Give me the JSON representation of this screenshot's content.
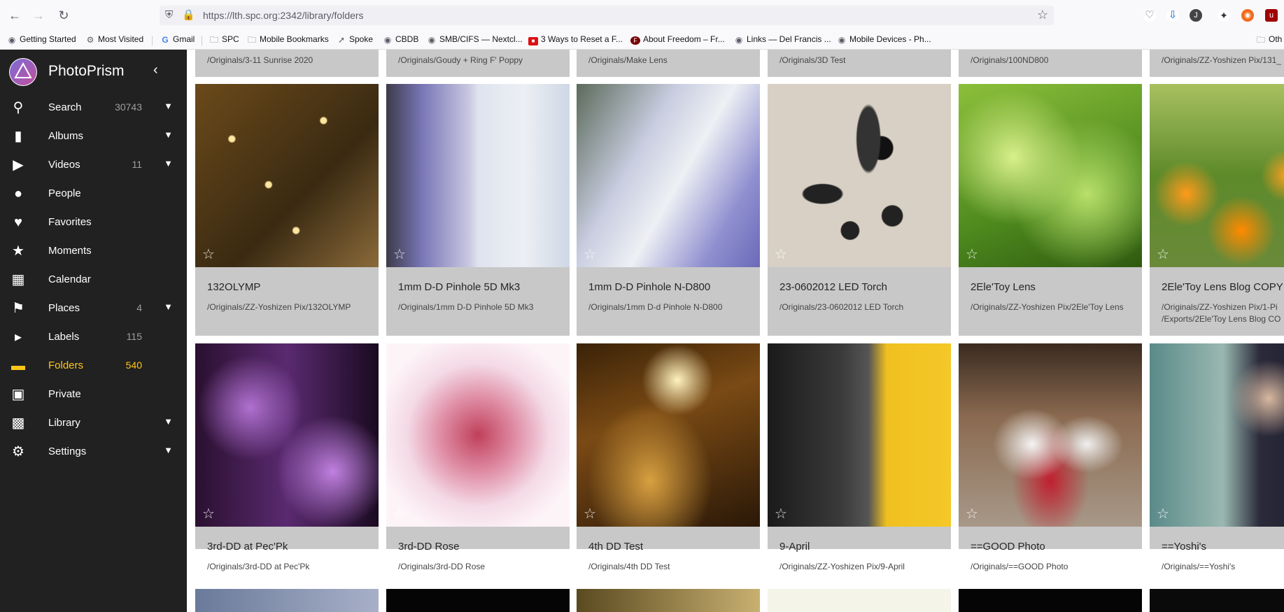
{
  "browser": {
    "url": "https://lth.spc.org:2342/library/folders",
    "bookmarks": [
      "Getting Started",
      "Most Visited",
      "Gmail",
      "SPC",
      "Mobile Bookmarks",
      "Spoke",
      "CBDB",
      "SMB/CIFS — Nextcl...",
      "3 Ways to Reset a F...",
      "About Freedom – Fr...",
      "Links — Del Francis ...",
      "Mobile Devices - Ph...",
      "Oth"
    ]
  },
  "app": {
    "title": "PhotoPrism"
  },
  "sidebar": {
    "items": [
      {
        "label": "Search",
        "count": "30743",
        "icon": "search-icon"
      },
      {
        "label": "Albums",
        "count": "",
        "icon": "bookmark-icon"
      },
      {
        "label": "Videos",
        "count": "11",
        "icon": "play-icon"
      },
      {
        "label": "People",
        "count": "",
        "icon": "person-icon"
      },
      {
        "label": "Favorites",
        "count": "",
        "icon": "heart-icon"
      },
      {
        "label": "Moments",
        "count": "",
        "icon": "star-icon"
      },
      {
        "label": "Calendar",
        "count": "",
        "icon": "calendar-icon"
      },
      {
        "label": "Places",
        "count": "4",
        "icon": "pin-icon"
      },
      {
        "label": "Labels",
        "count": "115",
        "icon": "label-icon"
      },
      {
        "label": "Folders",
        "count": "540",
        "icon": "folder-icon"
      },
      {
        "label": "Private",
        "count": "",
        "icon": "lock-icon"
      },
      {
        "label": "Library",
        "count": "",
        "icon": "library-icon"
      },
      {
        "label": "Settings",
        "count": "",
        "icon": "gear-icon"
      }
    ]
  },
  "top_row": [
    "/Originals/3-11 Sunrise 2020",
    "/Originals/Goudy + Ring F' Poppy",
    "/Originals/Make Lens",
    "/Originals/3D Test",
    "/Originals/100ND800",
    "/Originals/ZZ-Yoshizen Pix/131_"
  ],
  "row1": [
    {
      "title": "132OLYMP",
      "path": "/Originals/ZZ-Yoshizen Pix/132OLYMP",
      "path2": ""
    },
    {
      "title": "1mm D-D Pinhole 5D Mk3",
      "path": "/Originals/1mm D-D Pinhole 5D Mk3",
      "path2": ""
    },
    {
      "title": "1mm D-D Pinhole N-D800",
      "path": "/Originals/1mm D-d Pinhole N-D800",
      "path2": ""
    },
    {
      "title": "23-0602012 LED Torch",
      "path": "/Originals/23-0602012 LED Torch",
      "path2": ""
    },
    {
      "title": "2Ele'Toy Lens",
      "path": "/Originals/ZZ-Yoshizen Pix/2Ele'Toy Lens",
      "path2": ""
    },
    {
      "title": "2Ele'Toy Lens Blog COPY",
      "path": "/Originals/ZZ-Yoshizen Pix/1-Pi",
      "path2": "/Exports/2Ele'Toy Lens Blog CO"
    }
  ],
  "row2": [
    {
      "title": "3rd-DD at Pec'Pk",
      "path": "/Originals/3rd-DD at Pec'Pk"
    },
    {
      "title": "3rd-DD Rose",
      "path": "/Originals/3rd-DD Rose"
    },
    {
      "title": "4th DD Test",
      "path": "/Originals/4th DD Test"
    },
    {
      "title": "9-April",
      "path": "/Originals/ZZ-Yoshizen Pix/9-April"
    },
    {
      "title": "==GOOD Photo",
      "path": "/Originals/==GOOD Photo"
    },
    {
      "title": "==Yoshi's",
      "path": "/Originals/==Yoshi's"
    }
  ],
  "colors": {
    "accent": "#ffc61a",
    "sidebar": "#212121",
    "card": "#c8c8c8"
  }
}
